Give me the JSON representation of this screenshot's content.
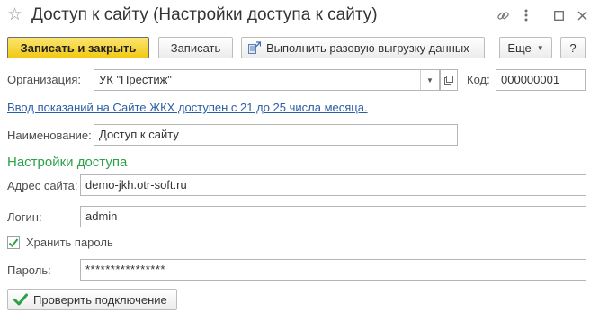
{
  "window": {
    "title": "Доступ к сайту (Настройки доступа к сайту)"
  },
  "toolbar": {
    "save_close_label": "Записать и закрыть",
    "save_label": "Записать",
    "export_label": "Выполнить разовую выгрузку данных",
    "more_label": "Еще",
    "help_label": "?"
  },
  "form": {
    "org_label": "Организация:",
    "org_value": "УК \"Престиж\"",
    "code_label": "Код:",
    "code_value": "000000001",
    "info_link": "Ввод показаний на Сайте ЖКХ доступен с 21 до 25 числа месяца.",
    "name_label": "Наименование:",
    "name_value": "Доступ к сайту",
    "section_title": "Настройки доступа",
    "site_label": "Адрес сайта:",
    "site_value": "demo-jkh.otr-soft.ru",
    "login_label": "Логин:",
    "login_value": "admin",
    "remember_label": "Хранить пароль",
    "remember_checked": true,
    "password_label": "Пароль:",
    "password_value": "****************",
    "check_button_label": "Проверить подключение"
  },
  "icons": {
    "favorite": "star-icon",
    "link": "link-icon",
    "more": "more-vert-icon",
    "maximize": "maximize-icon",
    "close": "close-icon",
    "export": "export-icon",
    "dropdown": "chevron-down-icon",
    "open": "open-icon",
    "check": "checkmark-icon"
  },
  "colors": {
    "primary_button": "#f5d33a",
    "link": "#2a5ea8",
    "section": "#2ca147",
    "check": "#2ca147"
  }
}
